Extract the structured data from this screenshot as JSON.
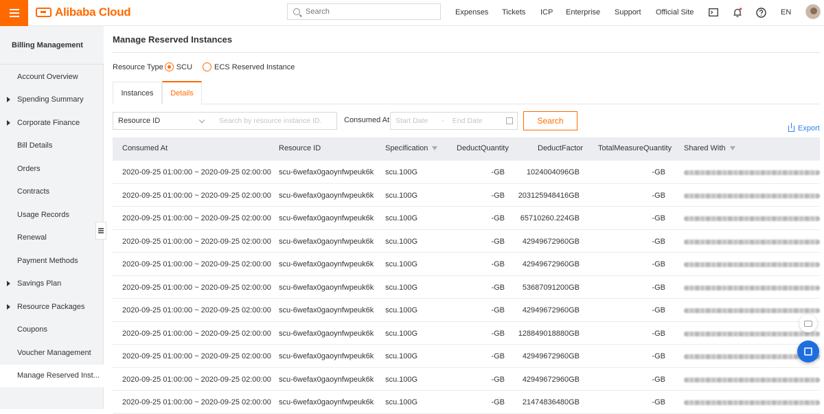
{
  "brand": {
    "name": "Alibaba Cloud",
    "accent": "#ff6a00"
  },
  "header": {
    "search_placeholder": "Search",
    "nav": [
      "Expenses",
      "Tickets",
      "ICP",
      "Enterprise",
      "Support",
      "Official Site"
    ],
    "language": "EN",
    "icons": [
      "terminal-icon",
      "bell-icon",
      "help-icon"
    ]
  },
  "sidebar": {
    "title": "Billing Management",
    "items": [
      {
        "label": "Account Overview",
        "expandable": false
      },
      {
        "label": "Spending Summary",
        "expandable": true
      },
      {
        "label": "Corporate Finance",
        "expandable": true
      },
      {
        "label": "Bill Details",
        "expandable": false
      },
      {
        "label": "Orders",
        "expandable": false
      },
      {
        "label": "Contracts",
        "expandable": false
      },
      {
        "label": "Usage Records",
        "expandable": false
      },
      {
        "label": "Renewal",
        "expandable": false
      },
      {
        "label": "Payment Methods",
        "expandable": false
      },
      {
        "label": "Savings Plan",
        "expandable": true
      },
      {
        "label": "Resource Packages",
        "expandable": true
      },
      {
        "label": "Coupons",
        "expandable": false
      },
      {
        "label": "Voucher Management",
        "expandable": false
      },
      {
        "label": "Manage Reserved Inst...",
        "expandable": false,
        "active": true
      }
    ]
  },
  "main": {
    "title": "Manage Reserved Instances",
    "resource_type": {
      "label": "Resource Type",
      "options": [
        "SCU",
        "ECS Reserved Instance"
      ],
      "selected": "SCU"
    },
    "tabs": [
      {
        "label": "Instances",
        "active": false
      },
      {
        "label": "Details",
        "active": true
      }
    ],
    "filters": {
      "select_value": "Resource ID",
      "search_placeholder": "Search by resource instance ID.",
      "consumed_label": "Consumed At",
      "start_placeholder": "Start Date",
      "end_placeholder": "End Date",
      "search_button": "Search",
      "export_label": "Export"
    },
    "table": {
      "columns": [
        "Consumed At",
        "Resource ID",
        "Specification",
        "DeductQuantity",
        "DeductFactor",
        "TotalMeasureQuantity",
        "Shared With"
      ],
      "rows": [
        [
          "2020-09-25 01:00:00 ~ 2020-09-25 02:00:00",
          "scu-6wefax0gaoynfwpeuk6k",
          "scu.100G",
          "-GB",
          "1024004096GB",
          "-GB"
        ],
        [
          "2020-09-25 01:00:00 ~ 2020-09-25 02:00:00",
          "scu-6wefax0gaoynfwpeuk6k",
          "scu.100G",
          "-GB",
          "203125948416GB",
          "-GB"
        ],
        [
          "2020-09-25 01:00:00 ~ 2020-09-25 02:00:00",
          "scu-6wefax0gaoynfwpeuk6k",
          "scu.100G",
          "-GB",
          "65710260.224GB",
          "-GB"
        ],
        [
          "2020-09-25 01:00:00 ~ 2020-09-25 02:00:00",
          "scu-6wefax0gaoynfwpeuk6k",
          "scu.100G",
          "-GB",
          "42949672960GB",
          "-GB"
        ],
        [
          "2020-09-25 01:00:00 ~ 2020-09-25 02:00:00",
          "scu-6wefax0gaoynfwpeuk6k",
          "scu.100G",
          "-GB",
          "42949672960GB",
          "-GB"
        ],
        [
          "2020-09-25 01:00:00 ~ 2020-09-25 02:00:00",
          "scu-6wefax0gaoynfwpeuk6k",
          "scu.100G",
          "-GB",
          "53687091200GB",
          "-GB"
        ],
        [
          "2020-09-25 01:00:00 ~ 2020-09-25 02:00:00",
          "scu-6wefax0gaoynfwpeuk6k",
          "scu.100G",
          "-GB",
          "42949672960GB",
          "-GB"
        ],
        [
          "2020-09-25 01:00:00 ~ 2020-09-25 02:00:00",
          "scu-6wefax0gaoynfwpeuk6k",
          "scu.100G",
          "-GB",
          "128849018880GB",
          "-GB"
        ],
        [
          "2020-09-25 01:00:00 ~ 2020-09-25 02:00:00",
          "scu-6wefax0gaoynfwpeuk6k",
          "scu.100G",
          "-GB",
          "42949672960GB",
          "-GB"
        ],
        [
          "2020-09-25 01:00:00 ~ 2020-09-25 02:00:00",
          "scu-6wefax0gaoynfwpeuk6k",
          "scu.100G",
          "-GB",
          "42949672960GB",
          "-GB"
        ],
        [
          "2020-09-25 01:00:00 ~ 2020-09-25 02:00:00",
          "scu-6wefax0gaoynfwpeuk6k",
          "scu.100G",
          "-GB",
          "21474836480GB",
          "-GB"
        ]
      ]
    }
  }
}
